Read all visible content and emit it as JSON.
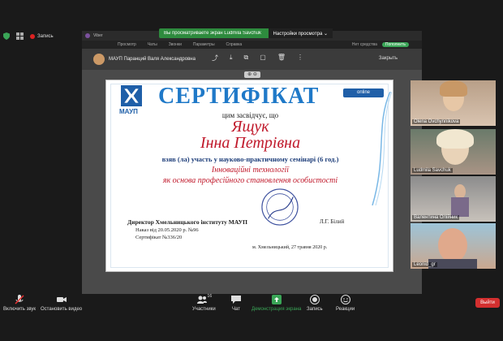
{
  "topbar": {
    "record_label": "Запись"
  },
  "share_banner": {
    "text": "Вы просматриваете экран Ludmila Savchuk",
    "options": "Настройки просмотра ⌄"
  },
  "viber": {
    "app_name": "Viber",
    "menu": [
      "Просмотр",
      "Чаты",
      "Звонки",
      "Параметры",
      "Справка"
    ],
    "right_items": [
      "Нет средства",
      "Пополнить"
    ],
    "chat_name": "МАУП Паранций Валя Александровна",
    "close_label": "Закрыть",
    "zoom_label": "⊕ ⊖"
  },
  "certificate": {
    "logo_text": "МАУП",
    "title": "СЕРТИФІКАТ",
    "online_badge": "online",
    "certify": "цим засвідчує, що",
    "surname": "Ящук",
    "given": "Інна Петрівна",
    "took_part": "взяв (ла) участь у науково-практичному семінарі (6 год.)",
    "topic_line1": "Інноваційні технології",
    "topic_line2": "як основа професійного становлення особистості",
    "director": "Директор Хмельницького інституту МАУП",
    "signer": "Л.Г. Білий",
    "order": "Наказ від 20.05.2020 р. №96",
    "cert_number": "Сертифікат №336/20",
    "place_date": "м. Хмельницький, 27 травня 2020 р."
  },
  "participants": [
    {
      "name": "Olena Ovchynnikova"
    },
    {
      "name": "Ludmila Savchuk"
    },
    {
      "name": "Валентина Олiйник"
    },
    {
      "name": "Leonid_gr"
    }
  ],
  "toolbar": {
    "mute": "Включить звук",
    "video": "Остановить видео",
    "participants": "Участники",
    "participants_count": "16",
    "chat": "Чат",
    "share": "Демонстрация экрана",
    "record": "Запись",
    "reactions": "Реакции",
    "leave": "Выйти"
  },
  "colors": {
    "cert_title": "#1f79c8",
    "cert_red": "#c0192b",
    "banner_green": "#2e8b3e",
    "leave_red": "#d32f2f"
  }
}
